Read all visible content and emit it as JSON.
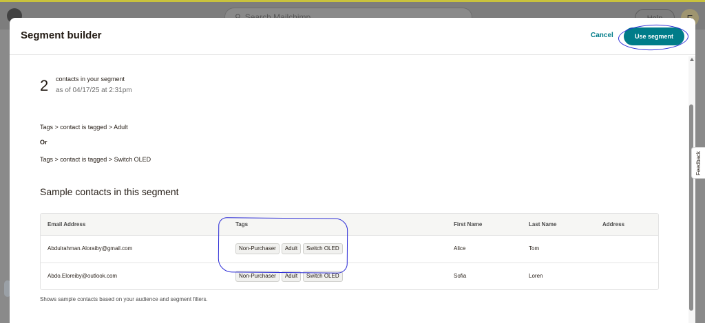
{
  "background": {
    "search_placeholder": "Search Mailchimp",
    "help_label": "Help",
    "avatar_initial": "E"
  },
  "modal": {
    "title": "Segment builder",
    "cancel_label": "Cancel",
    "use_segment_label": "Use segment",
    "feedback_label": "Feedback"
  },
  "summary": {
    "count": "2",
    "count_label": "contacts in your segment",
    "as_of": "as of 04/17/25 at 2:31pm"
  },
  "conditions": {
    "first": "Tags > contact is tagged > Adult",
    "operator": "Or",
    "second": "Tags > contact is tagged > Switch OLED"
  },
  "sample": {
    "title": "Sample contacts in this segment",
    "columns": [
      "Email Address",
      "Tags",
      "First Name",
      "Last Name",
      "Address"
    ],
    "rows": [
      {
        "email": "Abdulrahman.Aloraiby@gmail.com",
        "tags": [
          "Non-Purchaser",
          "Adult",
          "Switch OLED"
        ],
        "first_name": "Alice",
        "last_name": "Tom",
        "address": ""
      },
      {
        "email": "Abdo.Eloreiby@outlook.com",
        "tags": [
          "Non-Purchaser",
          "Adult",
          "Switch OLED"
        ],
        "first_name": "Sofia",
        "last_name": "Loren",
        "address": ""
      }
    ],
    "footnote": "Shows sample contacts based on your audience and segment filters."
  },
  "colors": {
    "accent": "#007c89",
    "annotation": "#2b2bd6"
  }
}
